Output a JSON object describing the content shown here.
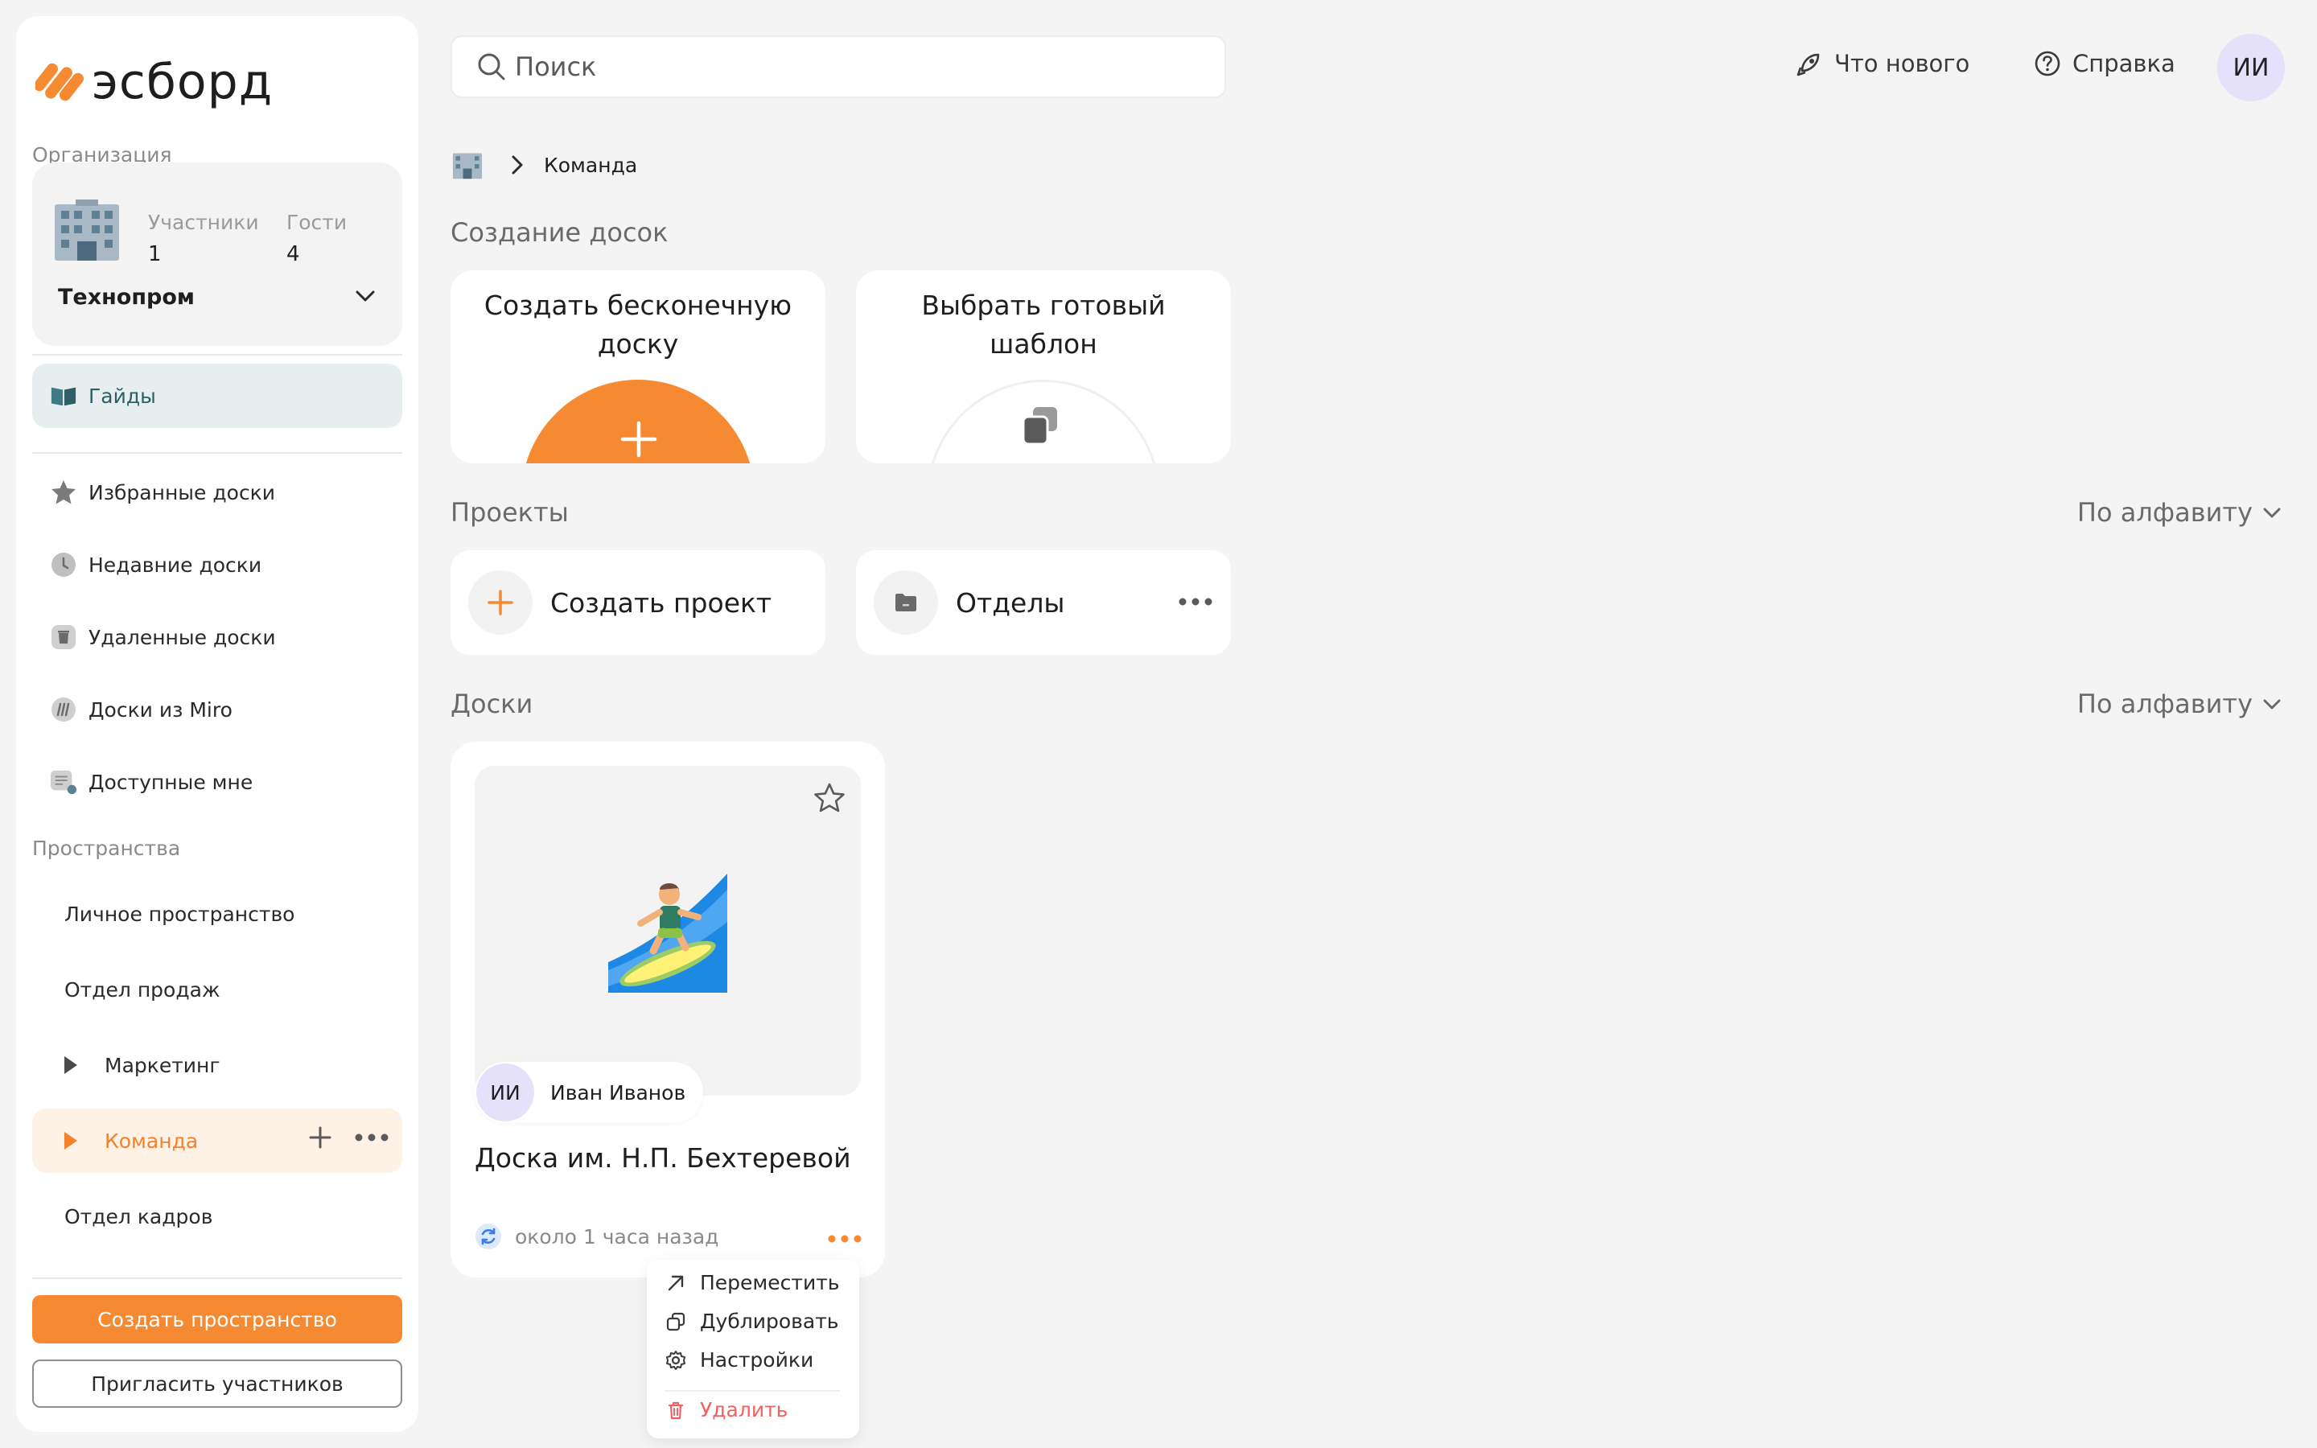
{
  "brand": {
    "name": "эсборд",
    "accent": "#F68A32"
  },
  "sidebar": {
    "org_label": "Организация",
    "org": {
      "members_label": "Участники",
      "members_count": "1",
      "guests_label": "Гости",
      "guests_count": "4",
      "name": "Технопром"
    },
    "nav": [
      {
        "label": "Гайды",
        "icon": "book-icon"
      },
      {
        "label": "Избранные доски",
        "icon": "star-icon"
      },
      {
        "label": "Недавние доски",
        "icon": "clock-icon"
      },
      {
        "label": "Удаленные доски",
        "icon": "trash-icon"
      },
      {
        "label": "Доски из Miro",
        "icon": "miro-icon"
      },
      {
        "label": "Доступные мне",
        "icon": "shared-icon"
      }
    ],
    "spaces_label": "Пространства",
    "spaces": [
      {
        "label": "Личное пространство"
      },
      {
        "label": "Отдел продаж"
      },
      {
        "label": "Маркетинг"
      },
      {
        "label": "Команда"
      },
      {
        "label": "Отдел кадров"
      }
    ],
    "create_space_label": "Создать пространство",
    "invite_label": "Пригласить участников"
  },
  "header": {
    "search_placeholder": "Поиск",
    "whats_new": "Что нового",
    "help": "Справка",
    "user_initials": "ИИ"
  },
  "breadcrumb": {
    "current": "Команда"
  },
  "create_section": {
    "title": "Создание досок",
    "infinite_board": "Создать бесконечную доску",
    "template": "Выбрать готовый шаблон"
  },
  "projects": {
    "title": "Проекты",
    "sort": "По алфавиту",
    "create": "Создать проект",
    "items": [
      {
        "label": "Отделы"
      }
    ]
  },
  "boards": {
    "title": "Доски",
    "sort": "По алфавиту",
    "items": [
      {
        "title": "Доска им. Н.П. Бехтеревой",
        "owner_initials": "ИИ",
        "owner_name": "Иван Иванов",
        "updated": "около 1 часа назад",
        "preview_icon": "surfer-icon"
      }
    ]
  },
  "context_menu": {
    "move": "Переместить",
    "duplicate": "Дублировать",
    "settings": "Настройки",
    "delete": "Удалить"
  }
}
